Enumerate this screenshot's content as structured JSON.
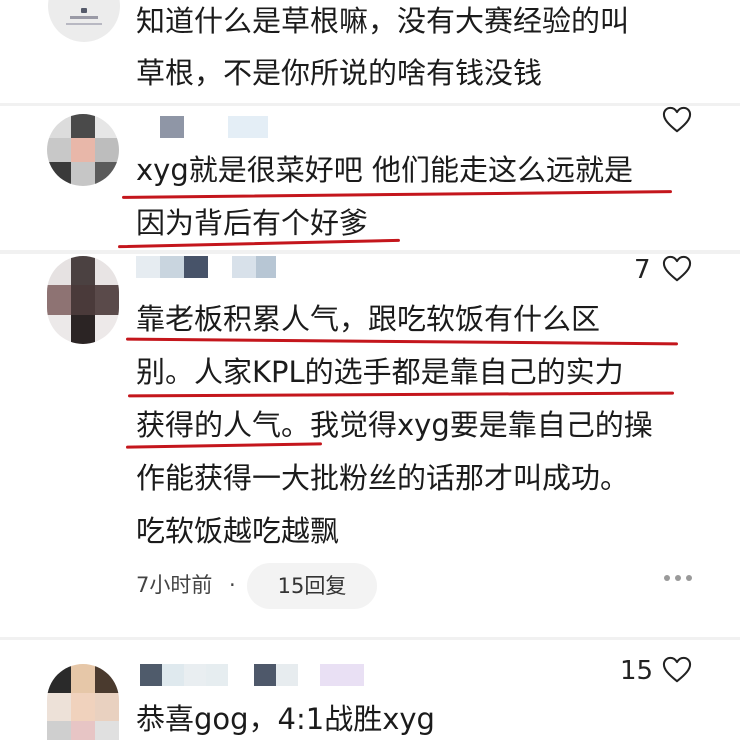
{
  "comments": [
    {
      "lines": [
        "知道什么是草根嘛，没有大赛经验的叫",
        "草根，不是你所说的啥有钱没钱"
      ]
    },
    {
      "lines": [
        "xyg就是很菜好吧 他们能走这么远就是",
        "因为背后有个好爹"
      ],
      "likes": ""
    },
    {
      "lines": [
        "靠老板积累人气，跟吃软饭有什么区",
        "别。人家KPL的选手都是靠自己的实力",
        "获得的人气。我觉得xyg要是靠自己的操",
        "作能获得一大批粉丝的话那才叫成功。",
        "吃软饭越吃越飘"
      ],
      "likes": "7",
      "time": "7小时前",
      "separator": "·",
      "replies": "15回复"
    },
    {
      "lines": [
        "恭喜gog，4:1战胜xyg"
      ],
      "likes": "15"
    }
  ],
  "colors": {
    "underline": "#c4161c",
    "reply_bg": "#f3f3f3",
    "text": "#1b1b1b"
  },
  "icons": [
    "heart-icon",
    "more-icon"
  ]
}
